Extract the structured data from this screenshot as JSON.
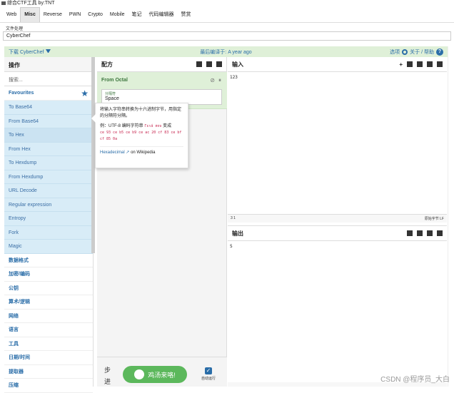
{
  "window": {
    "title": "综合CTF工具  by:TNT"
  },
  "menu": [
    "Web",
    "Misc",
    "Reverse",
    "PWN",
    "Crypto",
    "Mobile",
    "笔记",
    "代码编辑器",
    "赞赏"
  ],
  "active_menu": "Misc",
  "sub": {
    "label": "文件处理",
    "input_value": "CyberChef"
  },
  "banner": {
    "download": "下载 CyberChef",
    "compiled": "最后编译于: A year ago",
    "options": "选项",
    "about": "关于 / 帮助"
  },
  "operations": {
    "title": "操作",
    "search_placeholder": "搜索...",
    "favourites": "Favourites",
    "items": [
      "To Base64",
      "From Base64",
      "To Hex",
      "From Hex",
      "To Hexdump",
      "From Hexdump",
      "URL Decode",
      "Regular expression",
      "Entropy",
      "Fork",
      "Magic"
    ],
    "categories": [
      "数据格式",
      "加密/编码",
      "公钥",
      "算术/逻辑",
      "网络",
      "语言",
      "工具",
      "日期/时间",
      "提取器",
      "压缩"
    ]
  },
  "recipe": {
    "title": "配方",
    "op_title": "From Octal",
    "field_label": "分隔符",
    "field_value": "Space",
    "step": "步进",
    "bake": "鸡汤来咯!",
    "auto": "自动运行"
  },
  "tooltip": {
    "desc": "将输入字符串转换为十六进制字节，用指定的分隔符分隔。",
    "example_label": "例：UTF-8 编码字符串",
    "example_word": "Γειά σου",
    "becomes": "变成",
    "example_bytes": "ce 93 ce b5 ce b9 ce ac 20 cf 83 ce bf cf 85 0a",
    "link": "Hexadecimal",
    "on": "on Wikipedia"
  },
  "input": {
    "title": "输入",
    "value": "123",
    "status_left": "3",
    "status_mid": "1",
    "status_right": "原始字节",
    "status_eol": "LF"
  },
  "output": {
    "title": "输出",
    "value": "S"
  },
  "watermark": "CSDN @程序员_大白"
}
